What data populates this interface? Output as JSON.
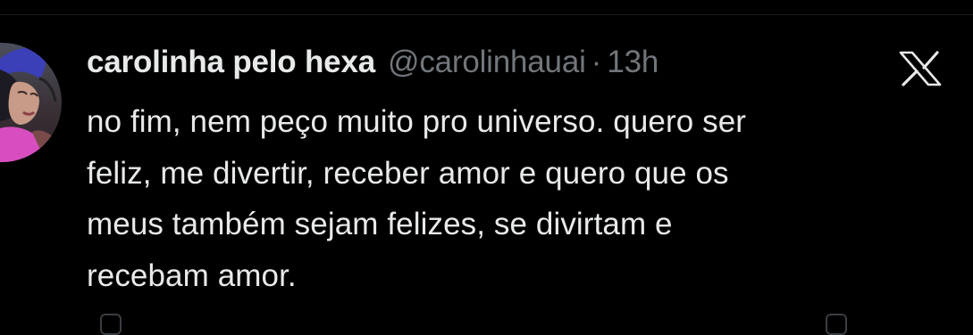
{
  "tweet": {
    "display_name": "carolinha pelo hexa",
    "handle": "@carolinhauai",
    "separator": "·",
    "time": "13h",
    "text_lines": [
      "no fim, nem peço muito pro universo. quero ser",
      "feliz, me divertir, receber amor e quero que os",
      "meus também sejam felizes, se divirtam e",
      "recebam amor."
    ]
  },
  "icons": {
    "brand": "x-logo-icon",
    "avatar": "avatar"
  },
  "colors": {
    "background": "#000000",
    "primary_text": "#e7e9ea",
    "secondary_text": "#71767b"
  }
}
